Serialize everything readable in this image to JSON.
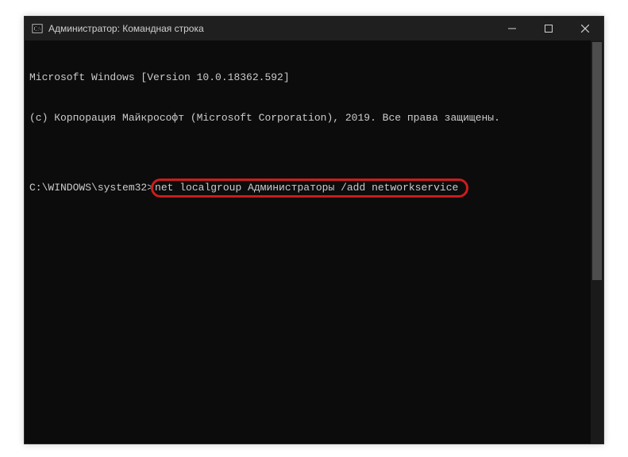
{
  "window": {
    "title": "Администратор: Командная строка"
  },
  "terminal": {
    "line1": "Microsoft Windows [Version 10.0.18362.592]",
    "line2": "(c) Корпорация Майкрософт (Microsoft Corporation), 2019. Все права защищены.",
    "blank": "",
    "prompt": "C:\\WINDOWS\\system32>",
    "command": "net localgroup Администраторы /add networkservice"
  },
  "highlight": {
    "color": "#cc1c1c"
  }
}
